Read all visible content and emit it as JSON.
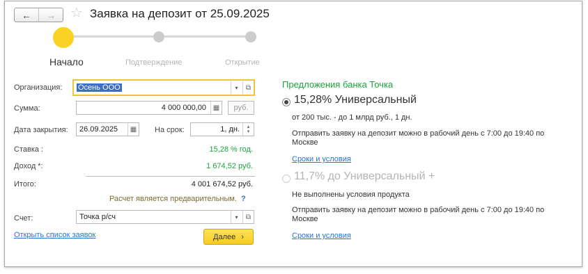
{
  "header": {
    "back_label": "←",
    "forward_label": "→",
    "star_label": "☆",
    "title": "Заявка на депозит от 25.09.2025"
  },
  "steps": [
    {
      "label": "Начало",
      "active": true
    },
    {
      "label": "Подтверждение",
      "active": false
    },
    {
      "label": "Открытие",
      "active": false
    }
  ],
  "form": {
    "org_label": "Организация:",
    "org_value": "Осень ООО",
    "sum_label": "Сумма:",
    "sum_value": "4 000 000,00",
    "sum_currency": "руб.",
    "date_label": "Дата закрытия:",
    "date_value": "26.09.2025",
    "term_label": "На срок:",
    "term_value": "1, дн.",
    "rate_label": "Ставка :",
    "rate_value": "15,28 % год.",
    "income_label": "Доход *:",
    "income_value": "1 674,52 руб.",
    "total_label": "Итого:",
    "total_value": "4 001 674,52 руб.",
    "note": "Расчет является предварительным.",
    "note_q": "?",
    "account_label": "Счет:",
    "account_value": "Точка р/сч",
    "open_list_link": "Открыть список заявок",
    "next_label": "Далее",
    "next_arrow": "›"
  },
  "offers": {
    "title": "Предложения банка Точка",
    "items": [
      {
        "name": "15,28% Универсальный",
        "selected": true,
        "line1": "от 200 тыс. - до 1 млрд руб., 1 дн.",
        "line2": "Отправить заявку на депозит можно в рабочий день с 7:00 до 19:40 по",
        "line3": "Москве",
        "link": "Сроки и условия"
      },
      {
        "name": "11,7% до Универсальный +",
        "selected": false,
        "line1": "Не выполнены условия продукта",
        "line2": "Отправить заявку на депозит можно в рабочий день с 7:00 до 19:40 по",
        "line3": "Москве",
        "link": "Сроки и условия"
      }
    ]
  },
  "colors": {
    "accent_yellow": "#f9d223",
    "green": "#19a33b",
    "link_blue": "#2c73c9",
    "selection_blue": "#3d6fc6"
  }
}
